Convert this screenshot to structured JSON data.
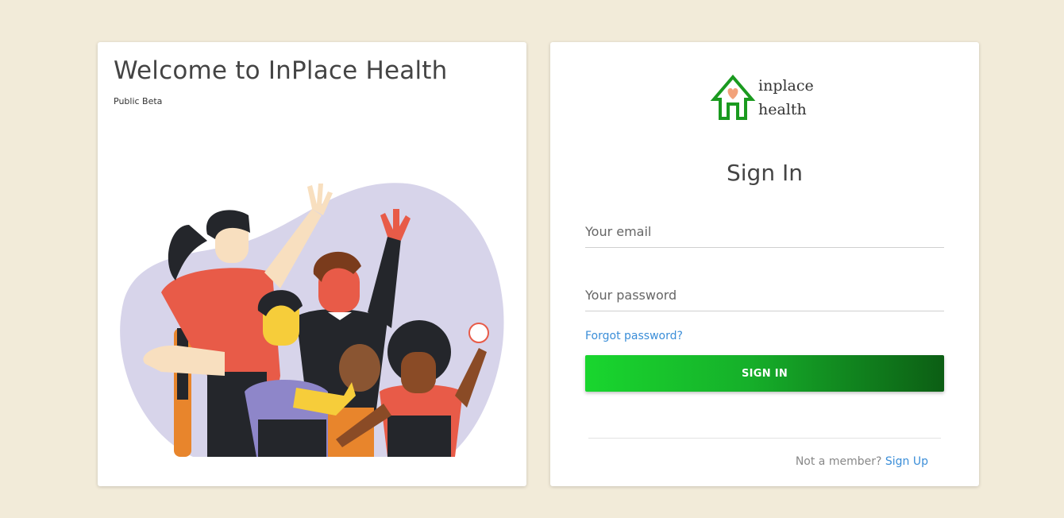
{
  "left_panel": {
    "title": "Welcome to InPlace Health",
    "subtitle": "Public Beta",
    "illustration": "group-of-people-illustration"
  },
  "right_panel": {
    "logo": {
      "line1": "inplace",
      "line2": "health",
      "icon": "house-heart-icon",
      "brand_color": "#1a9a1f",
      "heart_color": "#f2a27a"
    },
    "heading": "Sign In",
    "email_placeholder": "Your email",
    "password_placeholder": "Your password",
    "forgot_link": "Forgot password?",
    "submit_label": "SIGN IN",
    "footer_prompt": "Not a member?",
    "footer_link": "Sign Up"
  },
  "colors": {
    "background": "#f2ebd9",
    "link": "#3b8ed8",
    "button_start": "#19d62e",
    "button_end": "#0c5e14"
  }
}
